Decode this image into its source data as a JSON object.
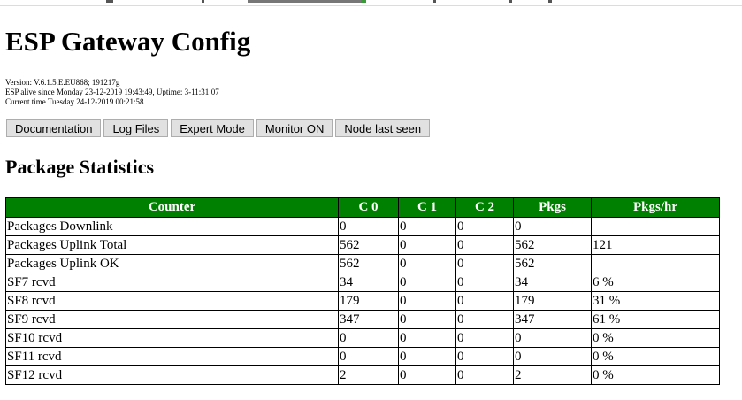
{
  "title": "ESP Gateway Config",
  "info": {
    "version": "Version: V.6.1.5.E.EU868; 191217g",
    "alive": "ESP alive since Monday 23-12-2019 19:43:49, Uptime: 3-11:31:07",
    "current_time": "Current time Tuesday 24-12-2019 00:21:58"
  },
  "buttons": {
    "documentation": "Documentation",
    "log_files": "Log Files",
    "expert_mode": "Expert Mode",
    "monitor": "Monitor ON",
    "node_last_seen": "Node last seen"
  },
  "section_title": "Package Statistics",
  "table": {
    "headers": [
      "Counter",
      "C 0",
      "C 1",
      "C 2",
      "Pkgs",
      "Pkgs/hr"
    ],
    "rows": [
      [
        "Packages Downlink",
        "0",
        "0",
        "0",
        "0",
        ""
      ],
      [
        "Packages Uplink Total",
        "562",
        "0",
        "0",
        "562",
        "121"
      ],
      [
        "Packages Uplink OK",
        "562",
        "0",
        "0",
        "562",
        ""
      ],
      [
        "SF7 rcvd",
        "34",
        "0",
        "0",
        "34",
        "6 %"
      ],
      [
        "SF8 rcvd",
        "179",
        "0",
        "0",
        "179",
        "31 %"
      ],
      [
        "SF9 rcvd",
        "347",
        "0",
        "0",
        "347",
        "61 %"
      ],
      [
        "SF10 rcvd",
        "0",
        "0",
        "0",
        "0",
        "0 %"
      ],
      [
        "SF11 rcvd",
        "0",
        "0",
        "0",
        "0",
        "0 %"
      ],
      [
        "SF12 rcvd",
        "2",
        "0",
        "0",
        "2",
        "0 %"
      ]
    ]
  },
  "colors": {
    "header_bg": "#008000",
    "header_text": "#ffffff",
    "button_bg": "#e1e1e1"
  }
}
